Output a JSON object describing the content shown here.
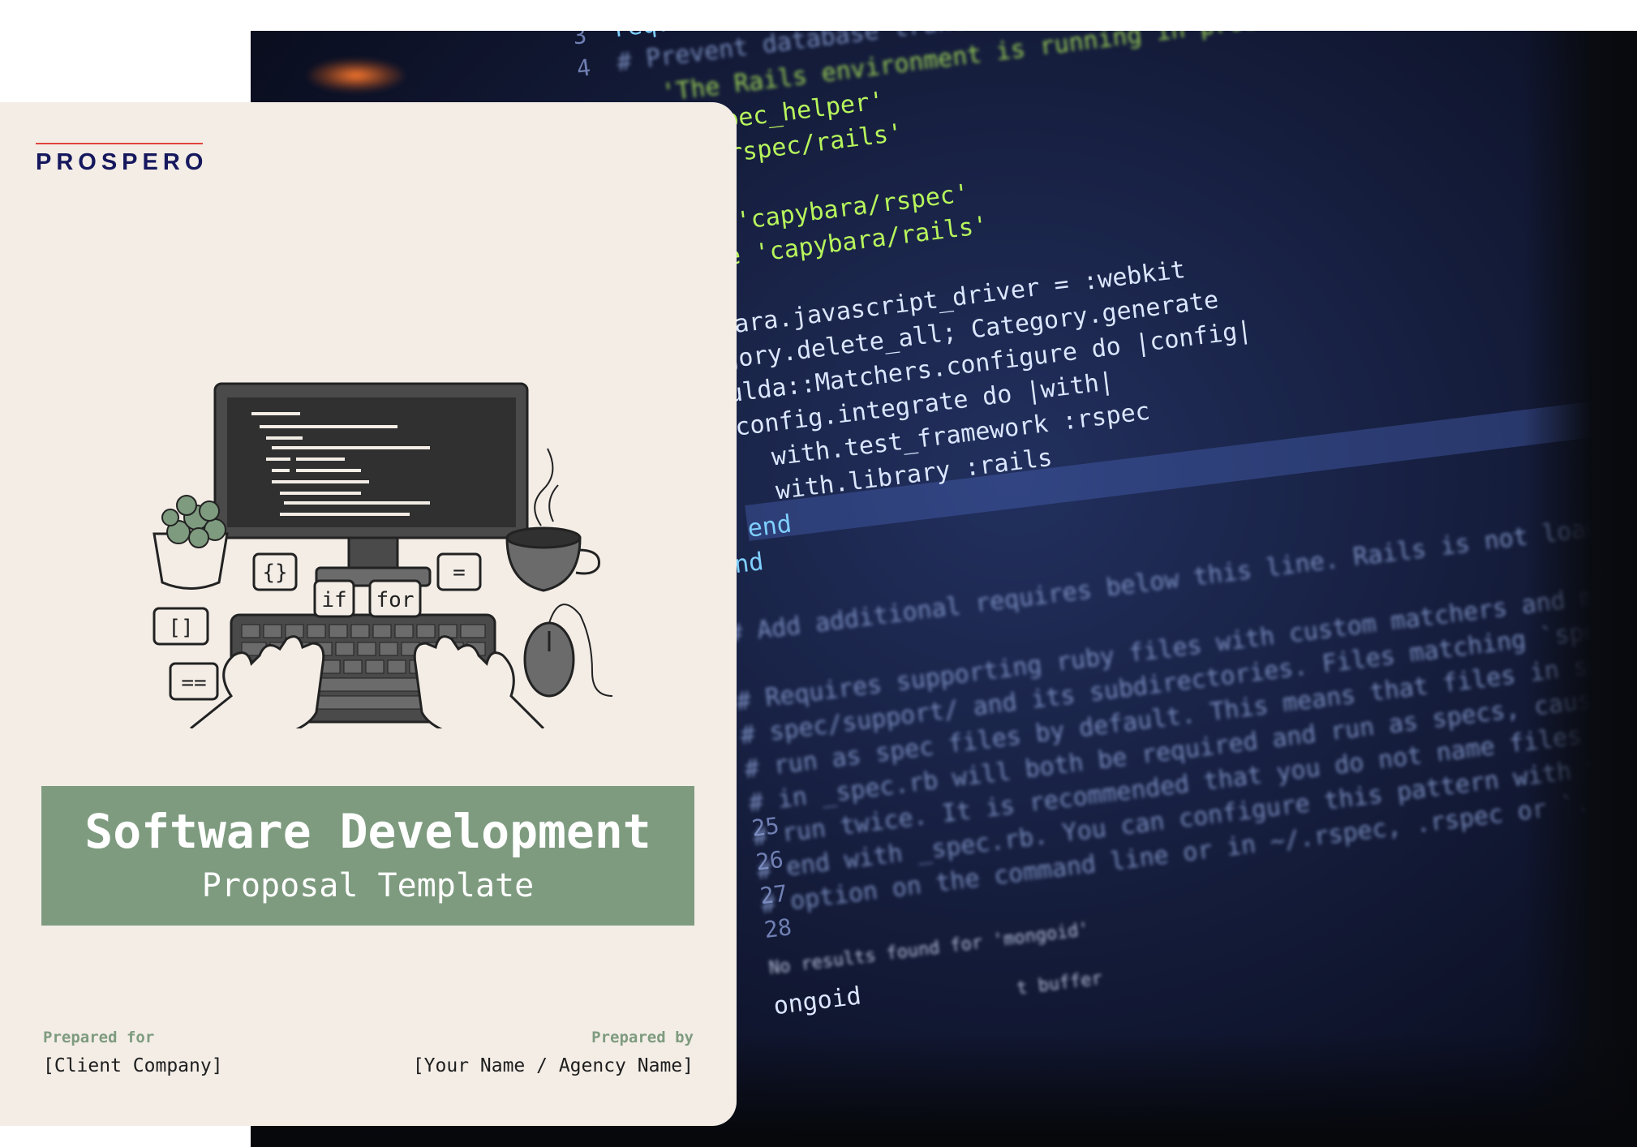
{
  "brand": {
    "logo": "PROSPERO",
    "accent_line_color": "#e2453d",
    "logo_color": "#16185e"
  },
  "cover": {
    "title": "Software Development",
    "subtitle": "Proposal Template",
    "band_color": "#7e9b7f",
    "background_color": "#f3ede6"
  },
  "prepared_for": {
    "label": "Prepared for",
    "value": "[Client Company]"
  },
  "prepared_by": {
    "label": "Prepared by",
    "value": "[Your Name / Agency Name]"
  },
  "illustration": {
    "bubbles": [
      "{}",
      "if",
      "for",
      "=",
      "[]",
      "==",
      "</>"
    ],
    "icons": [
      "computer-monitor-icon",
      "plant-icon",
      "coffee-cup-icon",
      "keyboard-icon",
      "mouse-icon",
      "hands-icon"
    ]
  },
  "background_code": {
    "line_numbers": [
      "3",
      "4",
      "25",
      "26",
      "27",
      "28"
    ],
    "lines": [
      "require File.expand_path('../../config/environment', __FILE__)",
      "# Prevent database truncation if the environment is production",
      "'The Rails environment is running in production mode!'",
      "e 'spec_helper'",
      "re 'rspec/rails'",
      "ire 'capybara/rspec'",
      "uire 'capybara/rails'",
      "pybara.javascript_driver = :webkit",
      "tegory.delete_all; Category.generate",
      "houlda::Matchers.configure do |config|",
      "config.integrate do |with|",
      "with.test_framework :rspec",
      "with.library :rails",
      "end",
      "end",
      "# Add additional requires below this line. Rails is not loaded until this point!",
      "# Requires supporting ruby files with custom matchers and macros, etc,",
      "# spec/support/ and its subdirectories. Files matching `spec/**/*_spec.rb` are",
      "# run as spec files by default. This means that files in spec/support that end",
      "# in _spec.rb will both be required and run as specs, causing the specs to be",
      "# run twice. It is recommended that you do not name files matching this glob to",
      "# end with _spec.rb. You can configure this pattern with the --pattern",
      "# option on the command line or in ~/.rspec, .rspec or `.rspec-local`.",
      "No results found for 'mongoid'",
      "ongoid",
      "t buffer"
    ]
  }
}
